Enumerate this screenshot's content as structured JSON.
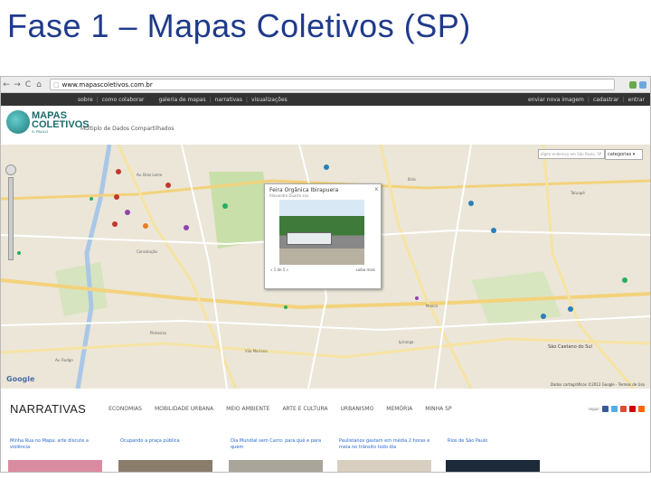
{
  "slide": {
    "title": "Fase 1 – Mapas Coletivos (SP)"
  },
  "browser": {
    "url": "www.mapascoletivos.com.br",
    "nav": {
      "back": "←",
      "forward": "→",
      "reload": "C",
      "home": "⌂"
    }
  },
  "topnav": {
    "left": [
      "sobre",
      "como colaborar"
    ],
    "mid": [
      "galeria de mapas",
      "narrativas",
      "visualizações"
    ],
    "right": [
      "enviar nova imagem",
      "cadastrar",
      "entrar"
    ]
  },
  "site": {
    "brand_line1": "MAPAS",
    "brand_line2": "COLETIVOS",
    "brand_line3": "S. PAULO",
    "tagline": "Múltiplo de Dados Compartilhados"
  },
  "map": {
    "search_placeholder": "digite endereço em São Paulo, SP",
    "select_value": "categorias",
    "popup": {
      "title": "Feira Orgânica Ibirapuera",
      "subtitle": "Alexandre Duarte xxx",
      "left_link": "« 1 de 5 »",
      "right_link": "saiba mais",
      "close": "x"
    },
    "google_mark": "Google",
    "copyright": "Dados cartográficos ©2012 Google - Termos de Uso",
    "places": [
      "Av. Braz Leme",
      "Av. Rudge",
      "Ipiranga",
      "Vila Mariana",
      "Mooca",
      "São Caetano do Sul",
      "Consolação",
      "Pinheiros",
      "Brás",
      "Tatuapé"
    ]
  },
  "narrativas": {
    "heading": "NARRATIVAS",
    "categories": [
      "ECONOMIAS",
      "MOBILIDADE URBANA",
      "MEIO AMBIENTE",
      "ARTE E CULTURA",
      "URBANISMO",
      "MEMÓRIA",
      "MINHA SP"
    ],
    "share_label": "seguir",
    "social_colors": [
      "#3b5998",
      "#55acee",
      "#dd4b39",
      "#cc0000",
      "#ff6600"
    ]
  },
  "cards": [
    {
      "title": "Minha Rua no Mapa: arte discute a violência"
    },
    {
      "title": "Ocupando a praça pública"
    },
    {
      "title": "Dia Mundial sem Carro: para quê e para quem"
    },
    {
      "title": "Paulistanos gastam em média 2 horas e meia no trânsito todo dia"
    },
    {
      "title": "Rios de São Paulo"
    }
  ],
  "colors": {
    "title": "#1f3a8a",
    "topnav_bg": "#333333",
    "brand": "#1d6b6b"
  }
}
